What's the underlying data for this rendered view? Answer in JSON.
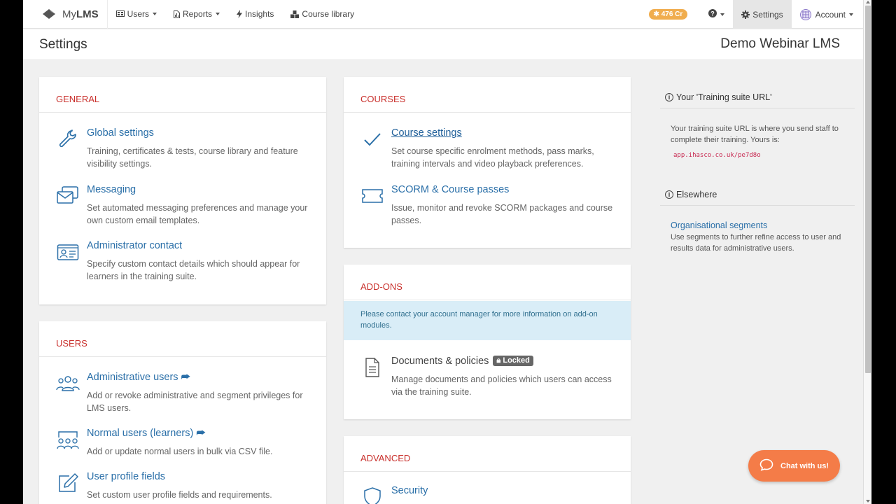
{
  "nav": {
    "brand_light": "My",
    "brand_bold": "LMS",
    "users": "Users",
    "reports": "Reports",
    "insights": "Insights",
    "course_library": "Course library",
    "credits": "476 Cr",
    "settings": "Settings",
    "account": "Account"
  },
  "header": {
    "title": "Settings",
    "org": "Demo Webinar LMS"
  },
  "general": {
    "heading": "GENERAL",
    "items": [
      {
        "label": "Global settings",
        "desc": "Training, certificates & tests, course library and feature visibility settings."
      },
      {
        "label": "Messaging",
        "desc": "Set automated messaging preferences and manage your own custom email templates."
      },
      {
        "label": "Administrator contact",
        "desc": "Specify custom contact details which should appear for learners in the training suite."
      }
    ]
  },
  "users": {
    "heading": "USERS",
    "items": [
      {
        "label": "Administrative users",
        "desc": "Add or revoke administrative and segment privileges for LMS users."
      },
      {
        "label": "Normal users (learners)",
        "desc": "Add or update normal users in bulk via CSV file."
      },
      {
        "label": "User profile fields",
        "desc": "Set custom user profile fields and requirements."
      }
    ]
  },
  "courses": {
    "heading": "COURSES",
    "items": [
      {
        "label": "Course settings",
        "desc": "Set course specific enrolment methods, pass marks, training intervals and video playback preferences."
      },
      {
        "label": "SCORM & Course passes",
        "desc": "Issue, monitor and revoke SCORM packages and course passes."
      }
    ]
  },
  "addons": {
    "heading": "ADD-ONS",
    "notice": "Please contact your account manager for more information on add-on modules.",
    "items": [
      {
        "label": "Documents & policies",
        "badge": "Locked",
        "desc": "Manage documents and policies which users can access via the training suite."
      }
    ]
  },
  "advanced": {
    "heading": "ADVANCED",
    "items": [
      {
        "label": "Security"
      }
    ]
  },
  "sidebar": {
    "url_heading": "Your 'Training suite URL'",
    "url_text": "Your training suite URL is where you send staff to complete their training. Yours is:",
    "url_value": "app.ihasco.co.uk/pe7d8o",
    "elsewhere_heading": "Elsewhere",
    "segments_link": "Organisational segments",
    "segments_desc": "Use segments to further refine access to user and results data for administrative users."
  },
  "chat": {
    "label": "Chat with us!"
  },
  "colors": {
    "link": "#2a6fa8",
    "section_heading": "#c9302c",
    "credits_badge": "#f0ad4e",
    "chat_button": "#f47c48",
    "notice_bg": "#d9edf7"
  }
}
